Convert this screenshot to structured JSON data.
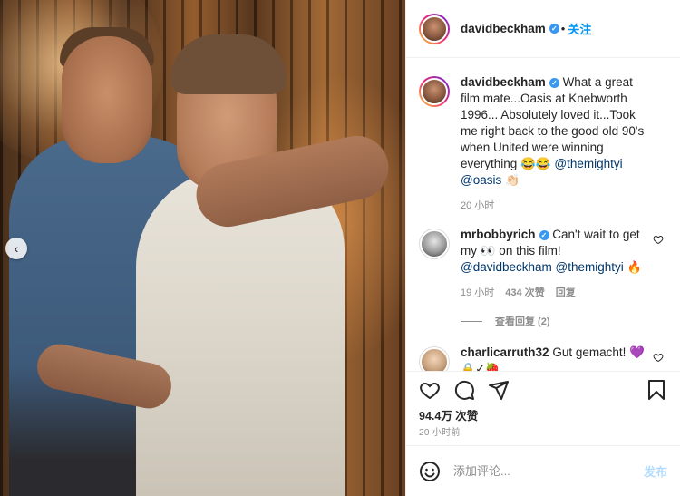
{
  "header": {
    "username": "davidbeckham",
    "follow_label": "关注",
    "separator": "•"
  },
  "caption": {
    "username": "davidbeckham",
    "text": "What a great film mate...Oasis at Knebworth 1996... Absolutely loved it...Took me right back to the good old 90's when United were winning everything 😂😂",
    "mention_1": "@themightyi",
    "mention_2": "@oasis",
    "trailing_emoji": "👏🏻",
    "time": "20 小时"
  },
  "comments": [
    {
      "username": "mrbobbyrich",
      "text": "Can't wait to get my 👀 on this film!",
      "mention_1": "@davidbeckham",
      "mention_2": "@themightyi",
      "trailing_emoji": "🔥",
      "time": "19 小时",
      "likes": "434 次赞",
      "reply_label": "回复",
      "view_replies": "查看回复 (2)"
    },
    {
      "username": "charlicarruth32",
      "text": "Gut gemacht! 💜",
      "second_line": "🔒✓🍓"
    }
  ],
  "likes_count": "94.4万 次赞",
  "post_time": "20 小时前",
  "add_comment": {
    "placeholder": "添加评论...",
    "post_label": "发布"
  },
  "icons": {
    "like": "heart-icon",
    "comment": "comment-icon",
    "share": "share-icon",
    "save": "bookmark-icon",
    "emoji": "emoji-icon",
    "carousel_prev": "chevron-left-icon"
  },
  "colors": {
    "link": "#00376b",
    "follow": "#0095f6",
    "verified": "#3897f0",
    "post_disabled": "#b3dbff",
    "muted": "#8e8e8e"
  }
}
